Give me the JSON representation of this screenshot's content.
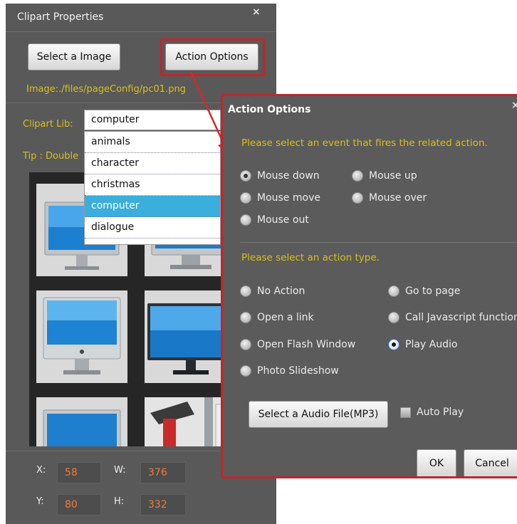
{
  "clipart_panel": {
    "title": "Clipart Properties",
    "close": "×",
    "select_image_label": "Select a Image",
    "action_options_label": "Action Options",
    "image_path": "Image:./files/pageConfig/pc01.png",
    "clipart_lib_label": "Clipart Lib:",
    "tip": "Tip : Double",
    "combo_value": "computer",
    "lib_options": [
      "animals",
      "character",
      "christmas",
      "computer",
      "dialogue"
    ],
    "selected_option": "computer",
    "coords": {
      "x_label": "X:",
      "x_value": "58",
      "w_label": "W:",
      "w_value": "376",
      "y_label": "Y:",
      "y_value": "80",
      "h_label": "H:",
      "h_value": "332"
    }
  },
  "action_dialog": {
    "title": "Action Options",
    "close": "×",
    "event_prompt": "Please select an event that fires the related action.",
    "events": [
      {
        "label": "Mouse down",
        "selected": true
      },
      {
        "label": "Mouse up",
        "selected": false
      },
      {
        "label": "Mouse move",
        "selected": false
      },
      {
        "label": "Mouse over",
        "selected": false
      },
      {
        "label": "Mouse out",
        "selected": false
      }
    ],
    "action_prompt": "Please select an action type.",
    "actions": [
      {
        "label": "No Action",
        "selected": false
      },
      {
        "label": "Go to page",
        "selected": false
      },
      {
        "label": "Open a link",
        "selected": false
      },
      {
        "label": "Call Javascript function",
        "selected": false
      },
      {
        "label": "Open Flash Window",
        "selected": false
      },
      {
        "label": "Play Audio",
        "selected": true
      },
      {
        "label": "Photo Slideshow",
        "selected": false
      }
    ],
    "select_audio_label": "Select a Audio File(MP3)",
    "auto_play_label": "Auto Play",
    "auto_play_checked": false,
    "ok_label": "OK",
    "cancel_label": "Cancel"
  },
  "colors": {
    "panel_bg": "#595959",
    "accent_yellow": "#d7c01a",
    "highlight_red": "#c0262b",
    "selection_blue": "#3aaedc",
    "coord_orange": "#ef7b3b"
  },
  "icons": [
    "close-icon",
    "monitor-icon",
    "imac-icon",
    "paint-roller-icon",
    "arrow-annotation"
  ]
}
